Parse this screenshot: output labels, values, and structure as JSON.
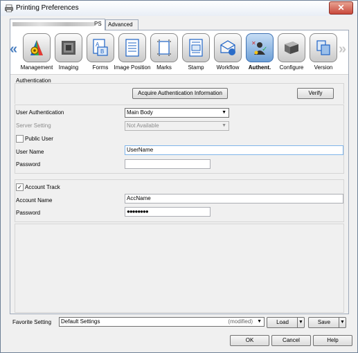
{
  "window": {
    "title": "Printing Preferences",
    "close": "✕",
    "icon": "printer-icon"
  },
  "tabs": [
    {
      "label": "PS",
      "selected": true
    },
    {
      "label": "Advanced",
      "selected": false
    }
  ],
  "iconbar": {
    "left_arrow": "«",
    "right_arrow": "»",
    "items": [
      {
        "label": "Management",
        "icon": "palette-icon"
      },
      {
        "label": "Imaging",
        "icon": "imaging-icon"
      },
      {
        "label": "Forms",
        "icon": "forms-icon"
      },
      {
        "label": "Image Position",
        "icon": "image-position-icon"
      },
      {
        "label": "Marks",
        "icon": "marks-icon"
      },
      {
        "label": "Stamp",
        "icon": "stamp-icon"
      },
      {
        "label": "Workflow",
        "icon": "workflow-icon"
      },
      {
        "label": "Authent.",
        "icon": "authentication-icon",
        "active": true
      },
      {
        "label": "Configure",
        "icon": "configure-icon"
      },
      {
        "label": "Version",
        "icon": "version-icon"
      }
    ]
  },
  "authentication": {
    "section_label": "Authentication",
    "acquire_button": "Acquire Authentication Information",
    "verify_button": "Verify",
    "user_auth_label": "User Authentication",
    "user_auth_value": "Main Body",
    "server_setting_label": "Server Setting",
    "server_setting_value": "Not Available",
    "public_user_label": "Public User",
    "public_user_checked": false,
    "user_name_label": "User Name",
    "user_name_value": "UserName",
    "password_label": "Password",
    "password_value": ""
  },
  "account": {
    "account_track_label": "Account Track",
    "account_track_checked": true,
    "check_mark": "✓",
    "account_name_label": "Account Name",
    "account_name_value": "AccName",
    "password_label": "Password",
    "password_value": "●●●●●●●●"
  },
  "favorite": {
    "label": "Favorite Setting",
    "value": "Default Settings",
    "modified": "(modified)",
    "load_button": "Load",
    "save_button": "Save"
  },
  "footer": {
    "ok": "OK",
    "cancel": "Cancel",
    "help": "Help"
  },
  "colors": {
    "accent": "#4a7fc0",
    "close": "#c9493c"
  }
}
